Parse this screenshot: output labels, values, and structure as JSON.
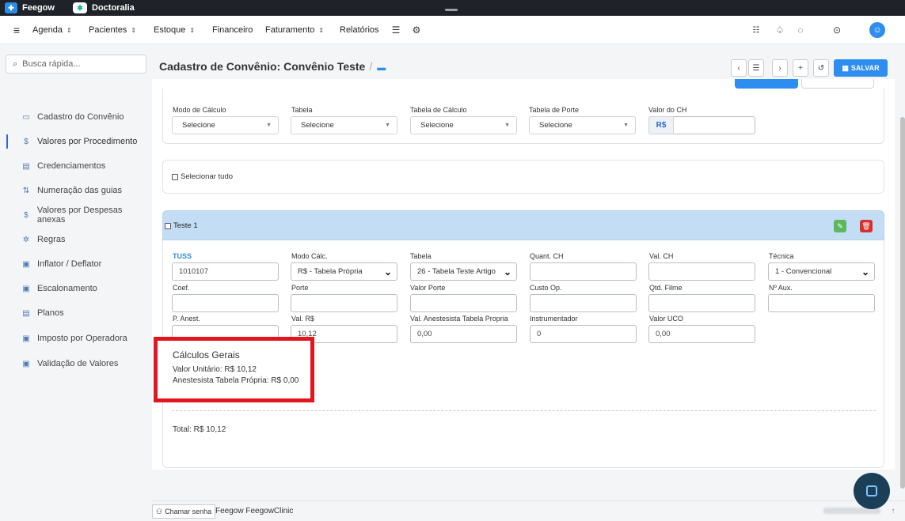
{
  "apps": {
    "feegow": "Feegow",
    "doctoralia": "Doctoralia"
  },
  "nav": {
    "menu_icon": "hamburger-icon",
    "items": [
      {
        "label": "Agenda",
        "has_caret": true
      },
      {
        "label": "Pacientes",
        "has_caret": true
      },
      {
        "label": "Estoque",
        "has_caret": true
      },
      {
        "label": "Financeiro",
        "has_caret": false
      },
      {
        "label": "Faturamento",
        "has_caret": true
      },
      {
        "label": "Relatórios",
        "has_caret": true
      }
    ],
    "caret": "⌃",
    "caret_down": "⌄"
  },
  "sidebar": {
    "search_placeholder": "Busca rápida...",
    "items": [
      {
        "label": "Cadastro do Convênio",
        "icon": "card-icon"
      },
      {
        "label": "Valores por Procedimento",
        "icon": "dollar-icon"
      },
      {
        "label": "Credenciamentos",
        "icon": "list-icon"
      },
      {
        "label": "Numeração das guias",
        "icon": "sort-icon"
      },
      {
        "label": "Valores por Despesas anexas",
        "icon": "dollar-icon"
      },
      {
        "label": "Regras",
        "icon": "gears-icon"
      },
      {
        "label": "Inflator / Deflator",
        "icon": "panel-icon"
      },
      {
        "label": "Escalonamento",
        "icon": "panel-icon"
      },
      {
        "label": "Planos",
        "icon": "list-icon"
      },
      {
        "label": "Imposto por Operadora",
        "icon": "panel-icon"
      },
      {
        "label": "Validação de Valores",
        "icon": "panel-icon"
      }
    ]
  },
  "header": {
    "title": "Cadastro de Convênio: Convênio Teste",
    "separator": "/",
    "save_label": "SALVAR"
  },
  "calc_filters": {
    "modo_calculo": {
      "label": "Modo de Cálculo",
      "value": "Selecione"
    },
    "tabela": {
      "label": "Tabela",
      "value": "Selecione"
    },
    "tabela_calculo": {
      "label": "Tabela de Cálculo",
      "value": "Selecione"
    },
    "tabela_porte": {
      "label": "Tabela de Porte",
      "value": "Selecione"
    },
    "valor_ch": {
      "label": "Valor do CH",
      "prefix": "R$",
      "value": ""
    }
  },
  "select_all": "Selecionar tudo",
  "procedure": {
    "name": "Teste 1",
    "fields": {
      "tuss": {
        "label": "TUSS",
        "value": "1010107"
      },
      "modo_calc": {
        "label": "Modo Cálc.",
        "value": "R$ - Tabela Própria"
      },
      "tabela": {
        "label": "Tabela",
        "value": "26 - Tabela Teste Artigo"
      },
      "quant_ch": {
        "label": "Quant. CH",
        "value": ""
      },
      "val_ch": {
        "label": "Val. CH",
        "value": ""
      },
      "tecnica": {
        "label": "Técnica",
        "value": "1 - Convencional"
      },
      "coef": {
        "label": "Coef.",
        "value": ""
      },
      "porte": {
        "label": "Porte",
        "value": ""
      },
      "valor_porte": {
        "label": "Valor Porte",
        "value": ""
      },
      "custo_op": {
        "label": "Custo Op.",
        "value": ""
      },
      "qtd_filme": {
        "label": "Qtd. Filme",
        "value": ""
      },
      "n_aux": {
        "label": "Nº Aux.",
        "value": ""
      },
      "p_anest": {
        "label": "P. Anest.",
        "value": ""
      },
      "val_rs": {
        "label": "Val. R$",
        "value": "10,12"
      },
      "val_anest": {
        "label": "Val. Anestesista Tabela Propria",
        "value": "0,00"
      },
      "instrumentador": {
        "label": "Instrumentador",
        "value": "0"
      },
      "valor_uco": {
        "label": "Valor UCO",
        "value": "0,00"
      }
    },
    "calculos": {
      "title": "Cálculos Gerais",
      "valor_unitario": "Valor Unitário: R$ 10,12",
      "anestesista": "Anestesista Tabela Própria: R$ 0,00"
    },
    "total": "Total: R$ 10,12"
  },
  "footer": {
    "chamar_senha": "Chamar senha",
    "clinic": "Feegow FeegowClinic"
  },
  "colors": {
    "accent": "#2e8ef0",
    "highlight": "#e2161c",
    "row_header": "#c3def4",
    "edit": "#5cb85c",
    "delete": "#d9302c"
  }
}
